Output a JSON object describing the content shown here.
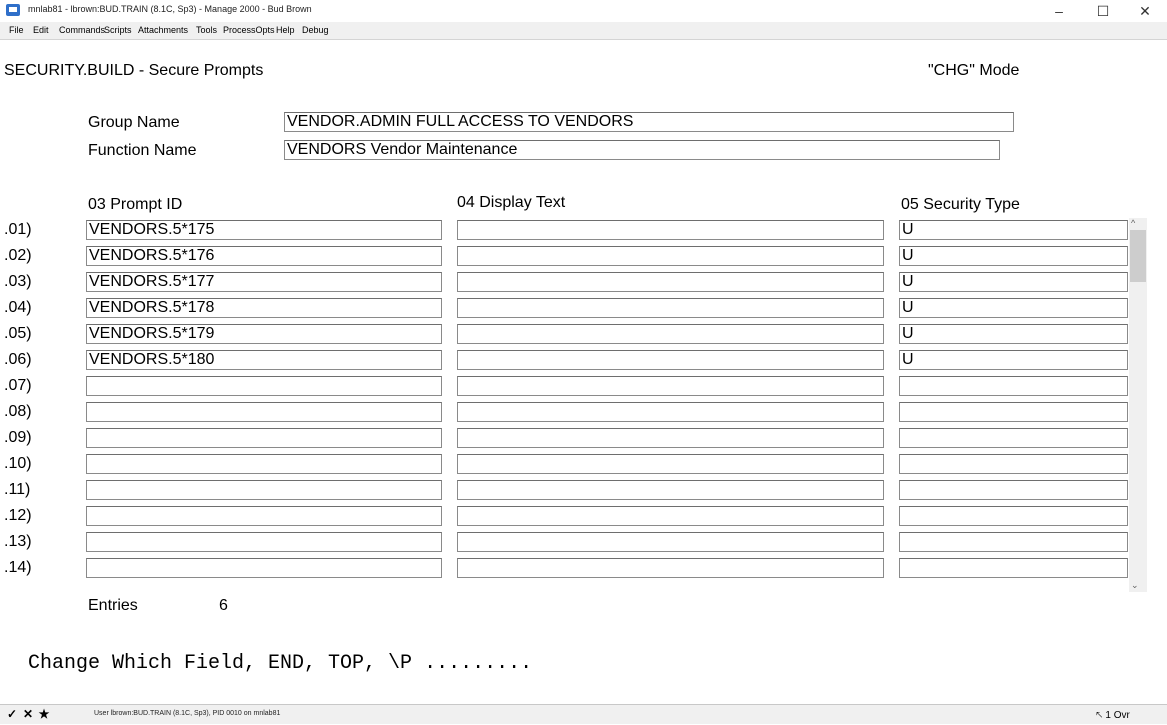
{
  "window": {
    "title": "mnlab81 - lbrown:BUD.TRAIN (8.1C, Sp3) - Manage 2000 - Bud Brown",
    "minimize": "–",
    "maximize": "☐",
    "close": "✕"
  },
  "menu": [
    "File",
    "Edit",
    "Commands",
    "Scripts",
    "Attachments",
    "Tools",
    "ProcessOpts",
    "Help",
    "Debug"
  ],
  "screen": {
    "title": "SECURITY.BUILD - Secure Prompts",
    "mode": "\"CHG\" Mode",
    "group_label": "Group Name",
    "group_value": "VENDOR.ADMIN  FULL ACCESS TO VENDORS",
    "function_label": "Function Name",
    "function_value": "VENDORS Vendor Maintenance",
    "col_prompt": "03   Prompt ID",
    "col_display": "04   Display Text",
    "col_security": "05   Security Type",
    "rows": [
      {
        "num": ".01)",
        "prompt": "VENDORS.5*175",
        "display": "",
        "security": "U"
      },
      {
        "num": ".02)",
        "prompt": "VENDORS.5*176",
        "display": "",
        "security": "U"
      },
      {
        "num": ".03)",
        "prompt": "VENDORS.5*177",
        "display": "",
        "security": "U"
      },
      {
        "num": ".04)",
        "prompt": "VENDORS.5*178",
        "display": "",
        "security": "U"
      },
      {
        "num": ".05)",
        "prompt": "VENDORS.5*179",
        "display": "",
        "security": "U"
      },
      {
        "num": ".06)",
        "prompt": "VENDORS.5*180",
        "display": "",
        "security": "U"
      },
      {
        "num": ".07)",
        "prompt": "",
        "display": "",
        "security": ""
      },
      {
        "num": ".08)",
        "prompt": "",
        "display": "",
        "security": ""
      },
      {
        "num": ".09)",
        "prompt": "",
        "display": "",
        "security": ""
      },
      {
        "num": ".10)",
        "prompt": "",
        "display": "",
        "security": ""
      },
      {
        "num": ".11)",
        "prompt": "",
        "display": "",
        "security": ""
      },
      {
        "num": ".12)",
        "prompt": "",
        "display": "",
        "security": ""
      },
      {
        "num": ".13)",
        "prompt": "",
        "display": "",
        "security": ""
      },
      {
        "num": ".14)",
        "prompt": "",
        "display": "",
        "security": ""
      }
    ],
    "entries_label": "Entries",
    "entries_value": "6",
    "command_prompt": "Change Which Field, END, TOP, \\P ........."
  },
  "status": {
    "check": "✓",
    "cancel": "✕",
    "star": "★",
    "text": "User lbrown:BUD.TRAIN (8.1C, Sp3), PID 0010 on mnlab81",
    "right": "1 Ovr"
  },
  "colors": {
    "menubar": "#f0f0f0",
    "app_icon": "#2f6fc9"
  }
}
